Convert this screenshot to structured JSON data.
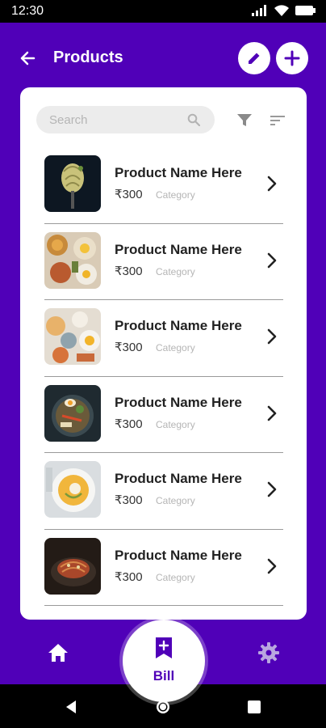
{
  "status_bar": {
    "time": "12:30"
  },
  "header": {
    "title": "Products"
  },
  "search": {
    "placeholder": "Search"
  },
  "products": [
    {
      "name": "Product Name Here",
      "price": "₹300",
      "category": "Category"
    },
    {
      "name": "Product Name Here",
      "price": "₹300",
      "category": "Category"
    },
    {
      "name": "Product Name Here",
      "price": "₹300",
      "category": "Category"
    },
    {
      "name": "Product Name Here",
      "price": "₹300",
      "category": "Category"
    },
    {
      "name": "Product Name Here",
      "price": "₹300",
      "category": "Category"
    },
    {
      "name": "Product Name Here",
      "price": "₹300",
      "category": "Category"
    }
  ],
  "bottom_nav": {
    "bill_label": "Bill"
  },
  "icons": [
    "back-arrow-icon",
    "pencil-icon",
    "plus-icon",
    "search-icon",
    "filter-icon",
    "sort-icon",
    "chevron-right-icon",
    "home-icon",
    "settings-gear-icon",
    "bill-bookmark-icon"
  ],
  "colors": {
    "brand": "#5000b8",
    "card": "#ffffff",
    "search_bg": "#ececec"
  }
}
